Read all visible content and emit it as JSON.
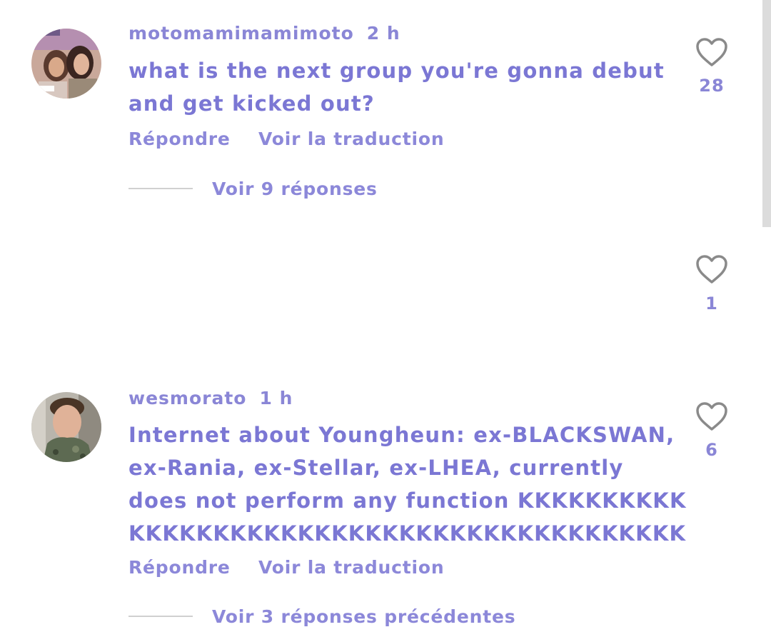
{
  "comments": [
    {
      "username": "motomamimamimoto",
      "time": "2 h",
      "text_lines": [
        "what is the next group you're gonna debut",
        "and get kicked out?"
      ],
      "reply_label": "Répondre",
      "translate_label": "Voir la traduction",
      "view_replies_label": "Voir 9 réponses",
      "likes": "28"
    },
    {
      "likes": "1"
    },
    {
      "username": "wesmorato",
      "time": "1 h",
      "text_lines": [
        "Internet about Youngheun: ex-BLACKSWAN,",
        "ex-Rania, ex-Stellar, ex-LHEA,  currently",
        "does not perform any function  KKKKKKKKKK",
        "KKKKKKKKKKKKKKKKKKKKKKKKKKKKKKKKK"
      ],
      "reply_label": "Répondre",
      "translate_label": "Voir la traduction",
      "view_replies_label": "Voir 3 réponses précédentes",
      "likes": "6"
    }
  ],
  "icons": {
    "like": "heart-outline-icon"
  },
  "colors": {
    "text": "#7b77d4",
    "icon": "#8a8a8a"
  }
}
